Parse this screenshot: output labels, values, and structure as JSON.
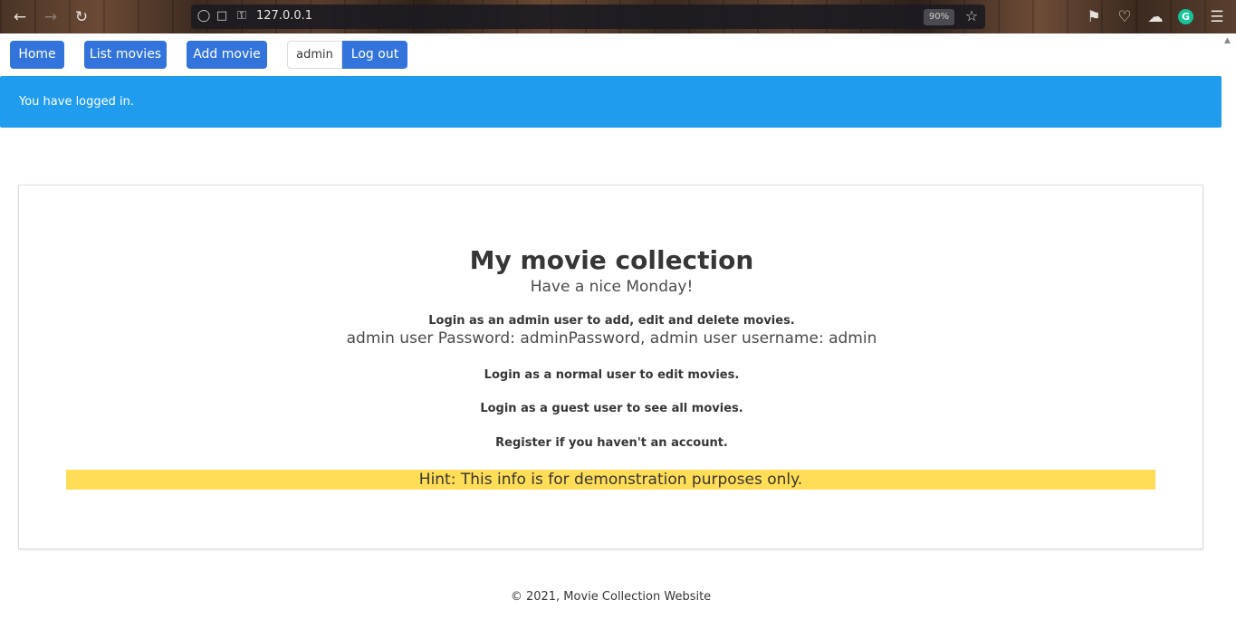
{
  "browser": {
    "url": "127.0.0.1",
    "zoom": "90%"
  },
  "nav": {
    "home_label": "Home",
    "list_label": "List movies",
    "add_label": "Add movie",
    "username": "admin",
    "logout_label": "Log out"
  },
  "notification": {
    "message": "You have logged in."
  },
  "card": {
    "title": "My movie collection",
    "subtitle": "Have a nice Monday!",
    "admin_line": "Login as an admin user to add, edit and delete movies.",
    "admin_credentials": "admin user Password: adminPassword, admin user username: admin",
    "normal_line": "Login as a normal user to edit movies.",
    "guest_line": "Login as a guest user to see all movies.",
    "register_line": "Register if you haven't an account.",
    "hint": "Hint: This info is for demonstration purposes only."
  },
  "footer": {
    "copyright": "© 2021, Movie Collection Website"
  },
  "colors": {
    "primary": "#3273dc",
    "info": "#209cee",
    "warning": "#ffdd57"
  }
}
